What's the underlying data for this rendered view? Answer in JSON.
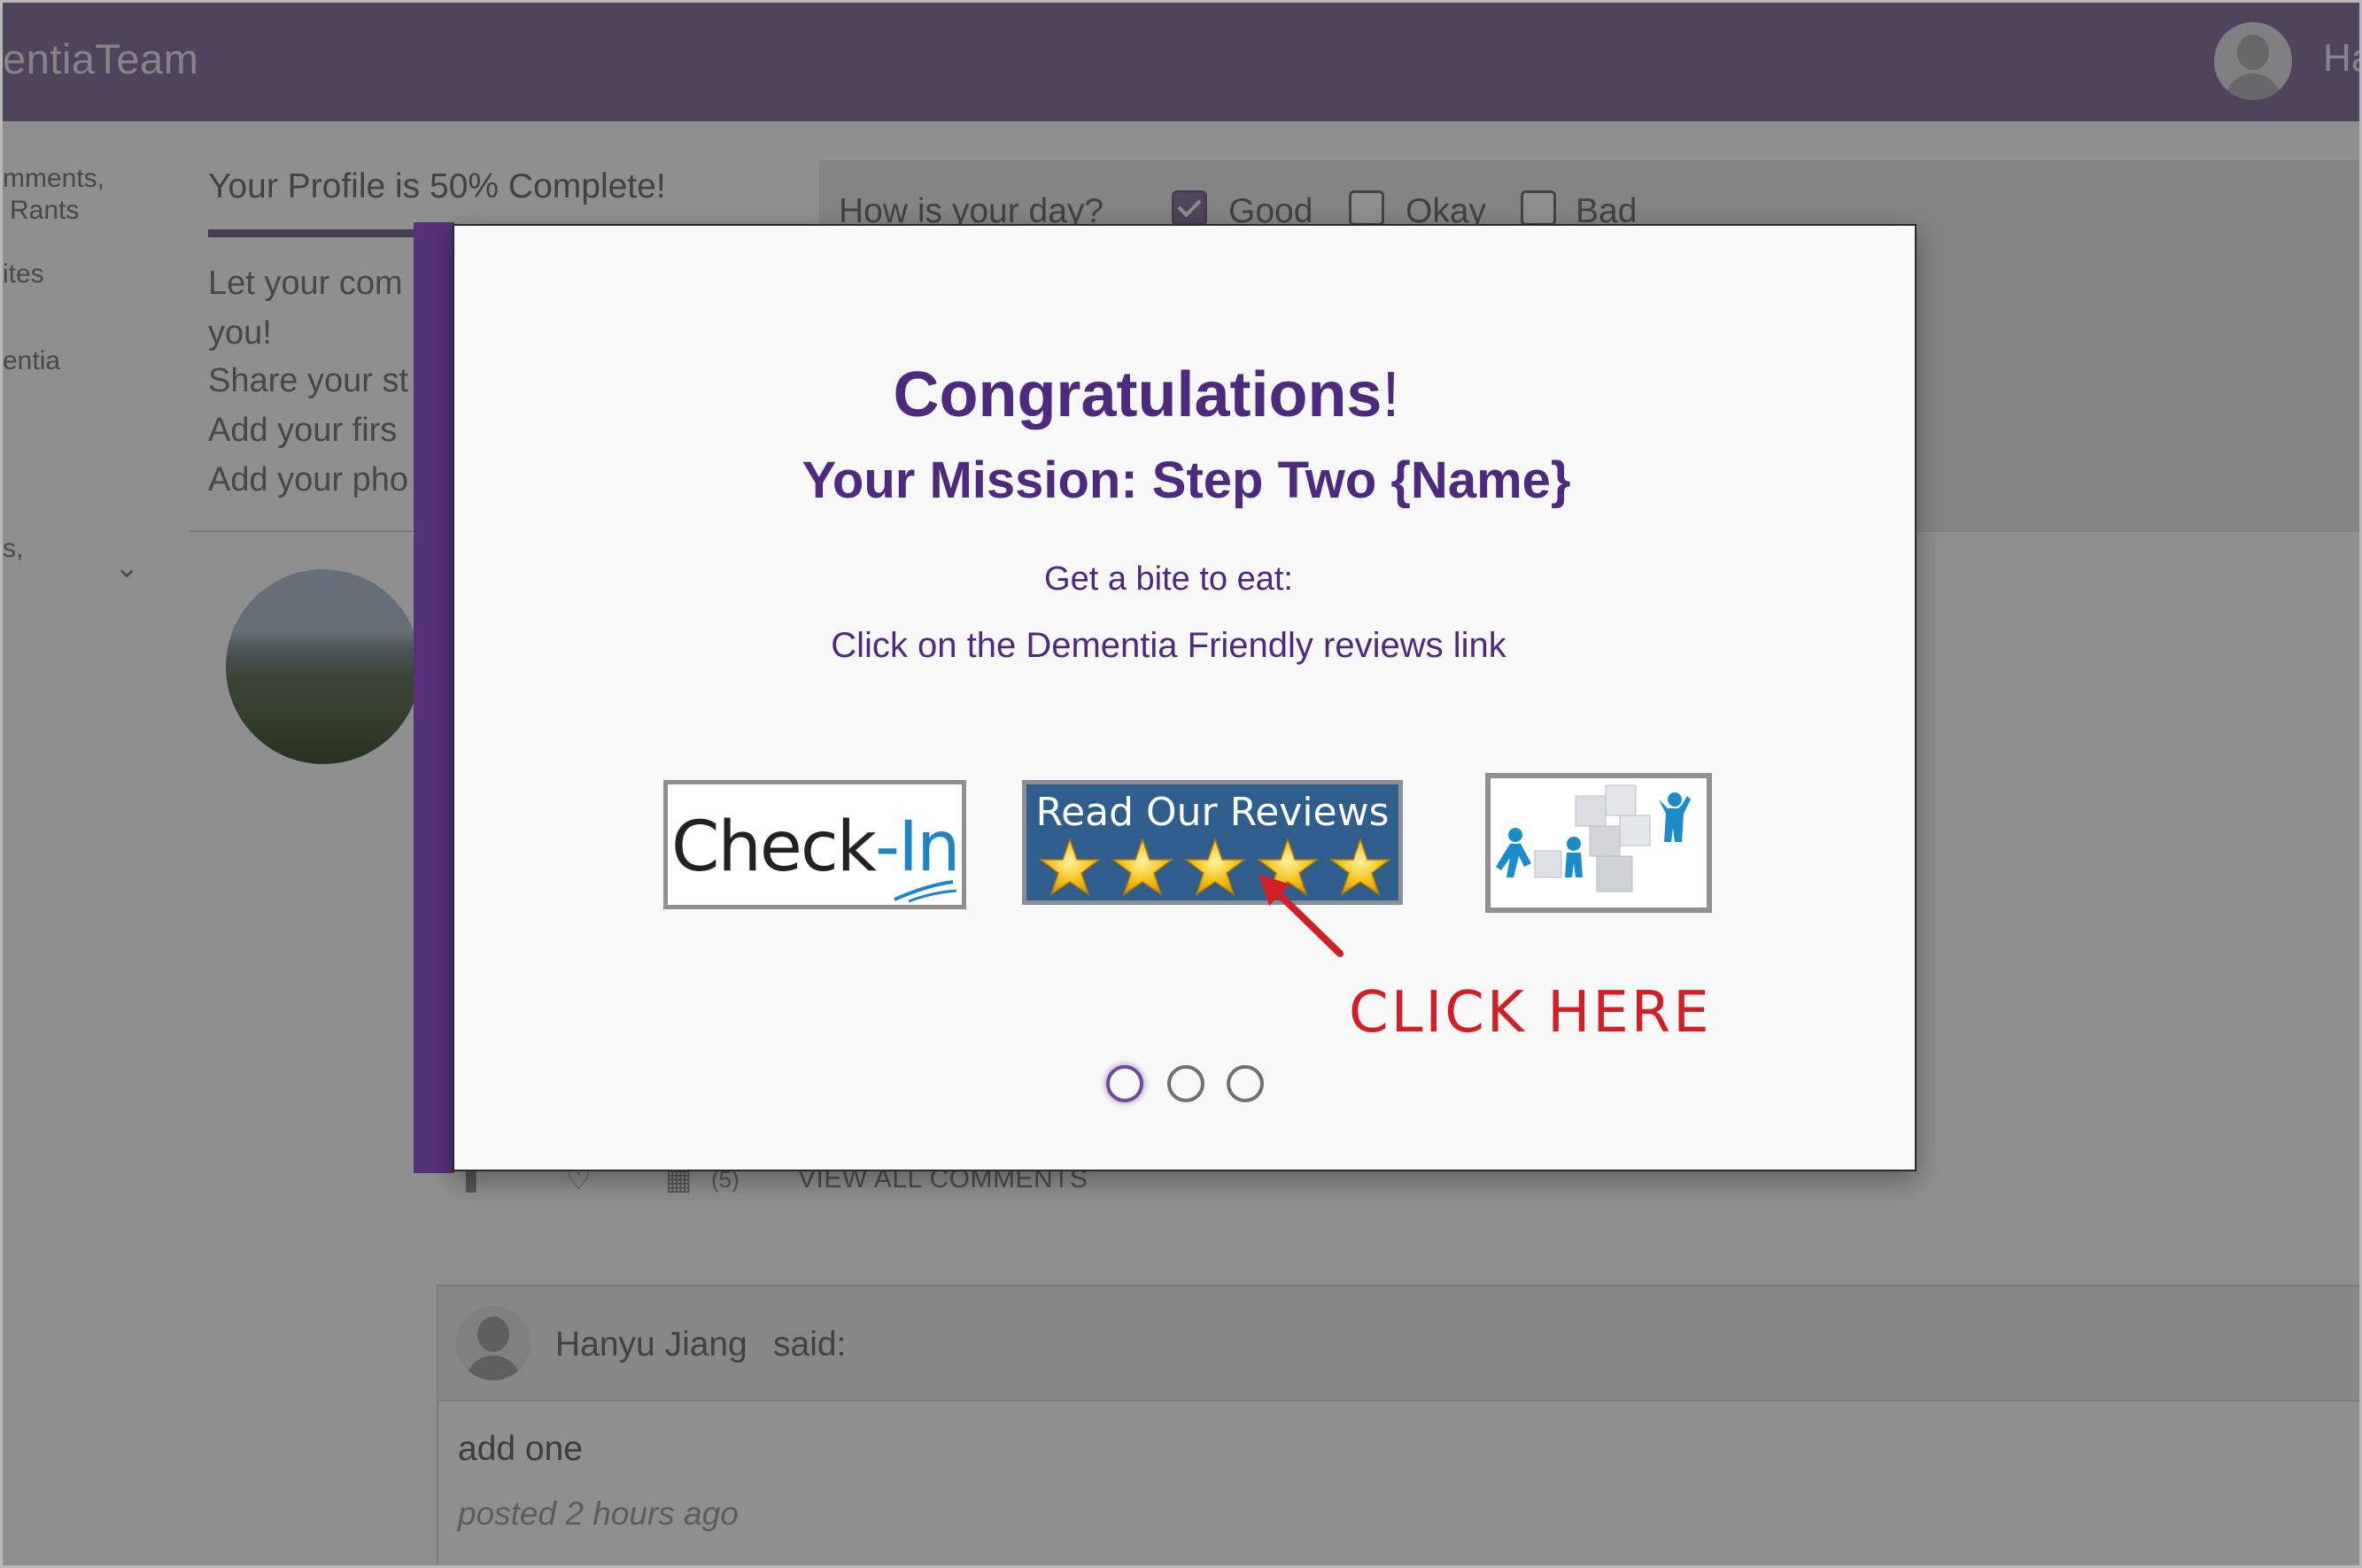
{
  "app": {
    "brand": "entiaTeam",
    "user_name": "Ha"
  },
  "left_nav": {
    "items": [
      "mments,",
      "Rants",
      "ites",
      "entia",
      "s,"
    ]
  },
  "profile": {
    "progress_text": "Your Profile is 50% Complete!",
    "progress_percent": 50,
    "tasks": [
      "Let your com",
      "you!",
      "Share your st",
      "Add your firs",
      "Add your pho"
    ]
  },
  "mood": {
    "question": "How is your day?",
    "options": [
      {
        "label": "Good",
        "checked": true
      },
      {
        "label": "Okay",
        "checked": false
      },
      {
        "label": "Bad",
        "checked": false
      }
    ]
  },
  "post": {
    "comment_count": "(5)",
    "view_all_label": "VIEW ALL COMMENTS"
  },
  "comment": {
    "author": "Hanyu Jiang",
    "said": "said:",
    "body": "add one",
    "time": "posted 2 hours ago"
  },
  "modal": {
    "title": "Congratulations",
    "title_mark": "!",
    "subtitle": "Your Mission: Step Two {Name}",
    "instruction_1": "Get a bite to eat:",
    "instruction_2": "Click on the Dementia Friendly reviews link",
    "tiles": {
      "checkin_part1": "Check",
      "checkin_part2": "-In",
      "reviews_label": "Read Our Reviews",
      "reviews_stars": 5
    },
    "callout": "CLICK HERE",
    "pagination": {
      "total": 3,
      "active": 1
    }
  },
  "colors": {
    "accent_purple": "#4e2a7f",
    "modal_sidebar": "#54317a",
    "callout_red": "#d11f26",
    "reviews_blue": "#2f5d8c",
    "star_gold": "#f5c21b"
  }
}
